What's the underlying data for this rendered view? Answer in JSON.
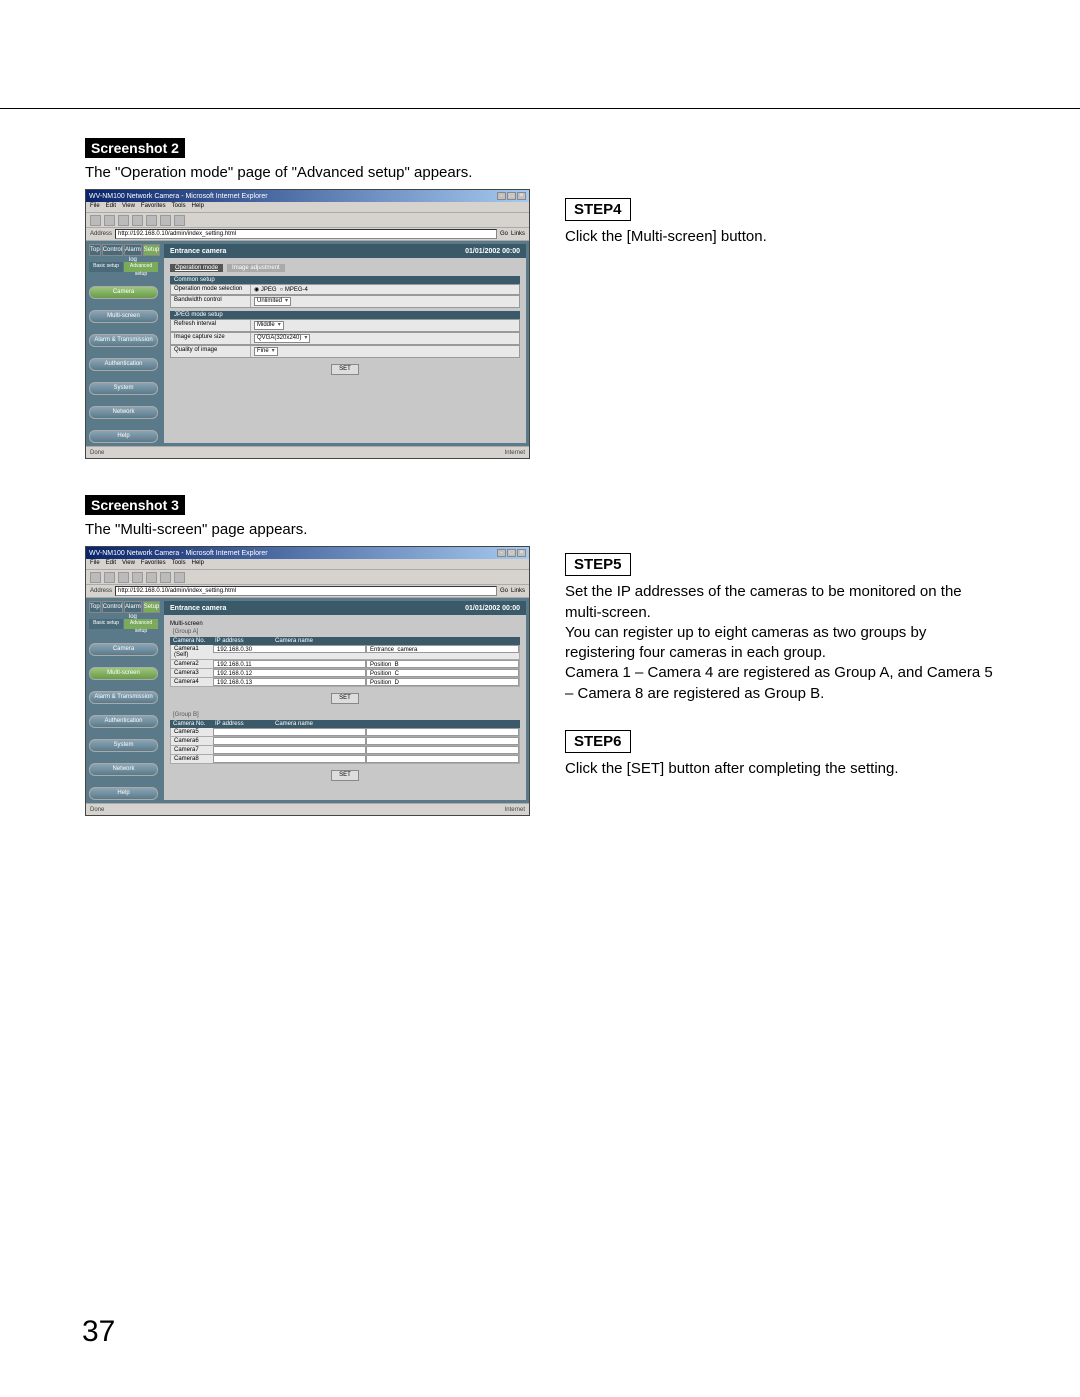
{
  "page_number": "37",
  "screenshot2": {
    "label": "Screenshot 2",
    "caption": "The \"Operation mode\" page of \"Advanced setup\" appears.",
    "window_title": "WV-NM100 Network Camera - Microsoft Internet Explorer",
    "menu": [
      "File",
      "Edit",
      "View",
      "Favorites",
      "Tools",
      "Help"
    ],
    "address_label": "Address",
    "address": "http://192.168.0.10/admin/index_setting.html",
    "go": "Go",
    "links": "Links",
    "status_left": "Done",
    "status_right": "Internet",
    "header_title": "Entrance camera",
    "header_date": "01/01/2002  00:00",
    "top_tabs": [
      "Top",
      "Control",
      "Alarm log",
      "Setup"
    ],
    "sub_tabs": [
      "Basic setup",
      "Advanced setup"
    ],
    "sidebar": [
      "Camera",
      "Multi-screen",
      "Alarm & Transmission",
      "Authentication",
      "System",
      "Network",
      "Help"
    ],
    "mini_tabs": [
      "Operation mode",
      "Image adjustment"
    ],
    "sec1_hdr": "Common setup",
    "r1_lbl": "Operation mode selection",
    "r1_opts": [
      "JPEG",
      "MPEG-4"
    ],
    "r2_lbl": "Bandwidth control",
    "r2_val": "Unlimited",
    "sec2_hdr": "JPEG mode setup",
    "r3_lbl": "Refresh interval",
    "r3_val": "Middle",
    "r4_lbl": "Image capture size",
    "r4_val": "QVGA(320x240)",
    "r5_lbl": "Quality of image",
    "r5_val": "Fine",
    "set_btn": "SET"
  },
  "screenshot3": {
    "label": "Screenshot 3",
    "caption": "The \"Multi-screen\" page appears.",
    "section_title": "Multi-screen",
    "group_a": "[Group A]",
    "group_b": "[Group B]",
    "col_no": "Camera No.",
    "col_ip": "IP address",
    "col_nm": "Camera name",
    "rowsA": [
      {
        "no": "Camera1 (Self)",
        "ip": "192.168.0.30",
        "nm": "Entrance_camera"
      },
      {
        "no": "Camera2",
        "ip": "192.168.0.11",
        "nm": "Position_B"
      },
      {
        "no": "Camera3",
        "ip": "192.168.0.12",
        "nm": "Position_C"
      },
      {
        "no": "Camera4",
        "ip": "192.168.0.13",
        "nm": "Position_D"
      }
    ],
    "rowsB": [
      {
        "no": "Camera5",
        "ip": "",
        "nm": ""
      },
      {
        "no": "Camera6",
        "ip": "",
        "nm": ""
      },
      {
        "no": "Camera7",
        "ip": "",
        "nm": ""
      },
      {
        "no": "Camera8",
        "ip": "",
        "nm": ""
      }
    ],
    "set_btn": "SET"
  },
  "step4": {
    "label": "STEP4",
    "text": "Click the [Multi-screen] button."
  },
  "step5": {
    "label": "STEP5",
    "text": "Set the IP addresses of the cameras to be monitored on the multi-screen.\nYou can register up to eight cameras as two groups by registering four cameras in each group.\nCamera 1 – Camera 4 are registered as Group A, and Camera 5 – Camera 8 are registered as Group B."
  },
  "step6": {
    "label": "STEP6",
    "text": "Click the [SET] button after completing the setting."
  }
}
